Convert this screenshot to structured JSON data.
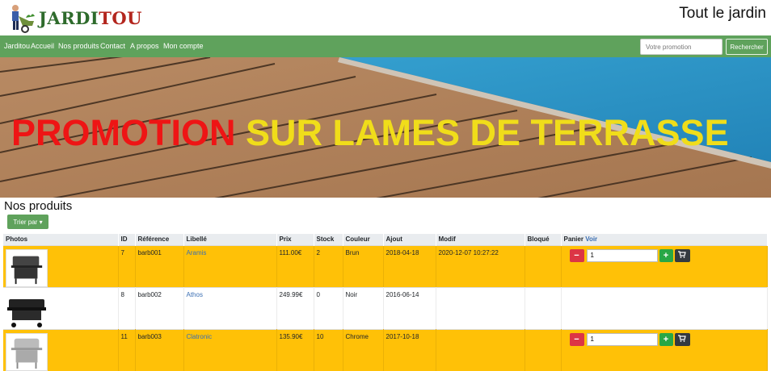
{
  "header": {
    "logo_part1": "JARDI",
    "logo_part2": "TOU",
    "site_title": "Tout le jardin"
  },
  "nav": {
    "items": [
      "Jarditou",
      "Accueil",
      "Nos produits",
      "Contact",
      "A propos",
      "Mon compte"
    ],
    "promo_placeholder": "Votre promotion",
    "search_label": "Rechercher"
  },
  "banner": {
    "word1": "PROMOTION",
    "word2": "SUR LAMES DE TERRASSE"
  },
  "products_title": "Nos produits",
  "sort_label": "Trier par",
  "table": {
    "headers": [
      "Photos",
      "ID",
      "Référence",
      "Libellé",
      "Prix",
      "Stock",
      "Couleur",
      "Ajout",
      "Modif",
      "Bloqué"
    ],
    "panier_label": "Panier",
    "voir_label": "Voir",
    "rows": [
      {
        "id": "7",
        "ref": "barb001",
        "libelle": "Aramis",
        "prix": "111.00€",
        "stock": "2",
        "couleur": "Brun",
        "ajout": "2018-04-18",
        "modif": "2020-12-07 10:27:22",
        "bloque": "",
        "qty": "1",
        "highlight": true,
        "cart": true
      },
      {
        "id": "8",
        "ref": "barb002",
        "libelle": "Athos",
        "prix": "249.99€",
        "stock": "0",
        "couleur": "Noir",
        "ajout": "2016-06-14",
        "modif": "",
        "bloque": "",
        "qty": "",
        "highlight": false,
        "cart": false
      },
      {
        "id": "11",
        "ref": "barb003",
        "libelle": "Clatronic",
        "prix": "135.90€",
        "stock": "10",
        "couleur": "Chrome",
        "ajout": "2017-10-18",
        "modif": "",
        "bloque": "",
        "qty": "1",
        "highlight": true,
        "cart": true
      }
    ]
  },
  "colors": {
    "nav_green": "#5fa25c",
    "row_highlight": "#ffc107",
    "promo_red": "#ee1515",
    "promo_yellow": "#f0dd1a"
  },
  "icons": [
    "gardener-logo-icon",
    "minus-icon",
    "plus-icon",
    "shopping-cart-icon",
    "caret-down-icon",
    "barbecue-photo"
  ]
}
